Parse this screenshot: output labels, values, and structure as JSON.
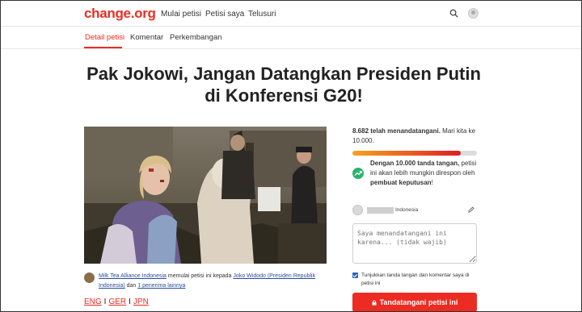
{
  "header": {
    "logo": "change.org",
    "nav": [
      "Mulai petisi",
      "Petisi saya",
      "Telusuri"
    ]
  },
  "tabs": [
    "Detail petisi",
    "Komentar",
    "Perkembangan"
  ],
  "petition": {
    "title": "Pak Jokowi, Jangan Datangkan Presiden Putin di Konferensi G20!",
    "starter_name": "Milk Tea Alliance Indonesia",
    "starter_middle": " memulai petisi ini kepada ",
    "recipient": "Joko Widodo (Presiden Republik Indonesia)",
    "and": " dan ",
    "other_recipients": "1 penerima lainnya",
    "languages": [
      "ENG",
      "GER",
      "JPN"
    ],
    "language_separator": "I"
  },
  "sidebar": {
    "signatures": "8.682 telah menandatangani.",
    "goal_text": " Mari kita ke 10.000.",
    "progress_fraction": 0.868,
    "trend_bold": "Dengan 10.000 tanda tangan,",
    "trend_middle": " petisi ini akan lebih mungkin direspon oleh ",
    "trend_bold_2": "pembuat keputusan",
    "trend_end": "!",
    "country": "Indonesia",
    "comment_placeholder": "Saya menandatangani ini karena... (tidak wajib)",
    "checkbox_checked": true,
    "checkbox_label": "Tunjukkan tanda tangan dan komentar saya di petisi ini",
    "sign_button": "Tandatangani petisi ini"
  },
  "colors": {
    "brand": "#ec2c22",
    "link": "#2a4d9c",
    "trend": "#2ab36b",
    "checkbox": "#2a64c4"
  },
  "icons": {
    "search": "search-icon",
    "avatar": "user-avatar",
    "trend": "trending-up-icon",
    "edit": "pencil-icon",
    "lock": "lock-icon"
  }
}
